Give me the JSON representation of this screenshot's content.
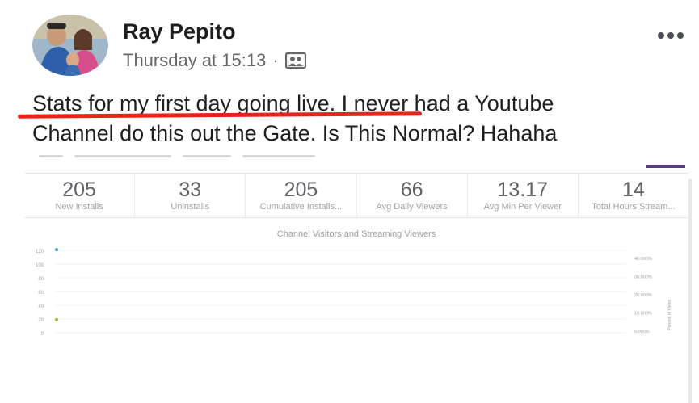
{
  "post": {
    "author_name": "Ray Pepito",
    "timestamp": "Thursday at 15:13",
    "separator": "·",
    "audience_icon": "friends-icon",
    "more_icon": "more-options-icon",
    "text_line_1": "Stats for my first day going live. I never had a Youtube",
    "text_line_2": "Channel do this out the Gate. Is This Normal? Hahaha",
    "underline_color": "#e8231a"
  },
  "stats": [
    {
      "value": "205",
      "label": "New Installs"
    },
    {
      "value": "33",
      "label": "Uninstalls"
    },
    {
      "value": "205",
      "label": "Cumulative Installs..."
    },
    {
      "value": "66",
      "label": "Avg Daily Viewers"
    },
    {
      "value": "13.17",
      "label": "Avg Min Per Viewer"
    },
    {
      "value": "14",
      "label": "Total Hours Stream..."
    }
  ],
  "chart_data": {
    "type": "scatter",
    "title": "Channel Visitors and Streaming Viewers",
    "y_left_ticks": [
      "0",
      "20",
      "40",
      "60",
      "80",
      "100",
      "120"
    ],
    "y_right_ticks": [
      "0.000%",
      "10.000%",
      "20.000%",
      "30.000%",
      "40.000%"
    ],
    "y_right_label": "Percent of Views",
    "ylim": [
      0,
      120
    ],
    "series": [
      {
        "color": "#4aa3c8",
        "values": [
          {
            "x": 0,
            "y": 121
          }
        ]
      },
      {
        "color": "#a9b23a",
        "values": [
          {
            "x": 0,
            "y": 19
          }
        ]
      }
    ],
    "grid": true
  }
}
